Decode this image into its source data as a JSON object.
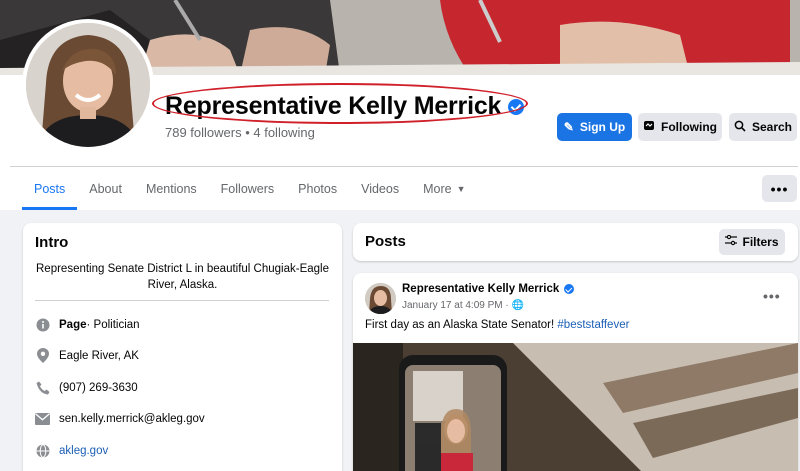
{
  "profile": {
    "name": "Representative Kelly Merrick",
    "followers_line": "789 followers • 4 following"
  },
  "actions": {
    "signup_label": "Sign Up",
    "following_label": "Following",
    "search_label": "Search"
  },
  "tabs": [
    {
      "label": "Posts"
    },
    {
      "label": "About"
    },
    {
      "label": "Mentions"
    },
    {
      "label": "Followers"
    },
    {
      "label": "Photos"
    },
    {
      "label": "Videos"
    },
    {
      "label": "More"
    }
  ],
  "more_menu": "•••",
  "intro": {
    "title": "Intro",
    "bio": "Representing Senate District L in beautiful Chugiak-Eagle River, Alaska.",
    "page_label": "Page",
    "page_category": " · Politician",
    "location": "Eagle River, AK",
    "phone": "(907) 269-3630",
    "email": "sen.kelly.merrick@akleg.gov",
    "website": "akleg.gov"
  },
  "posts": {
    "title": "Posts",
    "filters_label": "Filters"
  },
  "post": {
    "author": "Representative Kelly Merrick",
    "date": "January 17 at 4:09 PM · ",
    "menu": "•••",
    "text": "First day as an Alaska State Senator! ",
    "hashtag": "#beststaffever"
  },
  "colors": {
    "accent": "#1877f2",
    "primary_button": "#1b74e4",
    "highlight_outline": "#d0202a",
    "background": "#f0f2f5"
  },
  "icons": [
    "verified-badge-icon",
    "pencil-icon",
    "messenger-icon",
    "search-icon",
    "chevron-down-icon",
    "filters-icon",
    "info-icon",
    "location-pin-icon",
    "phone-icon",
    "email-icon",
    "globe-icon",
    "public-globe-icon"
  ]
}
